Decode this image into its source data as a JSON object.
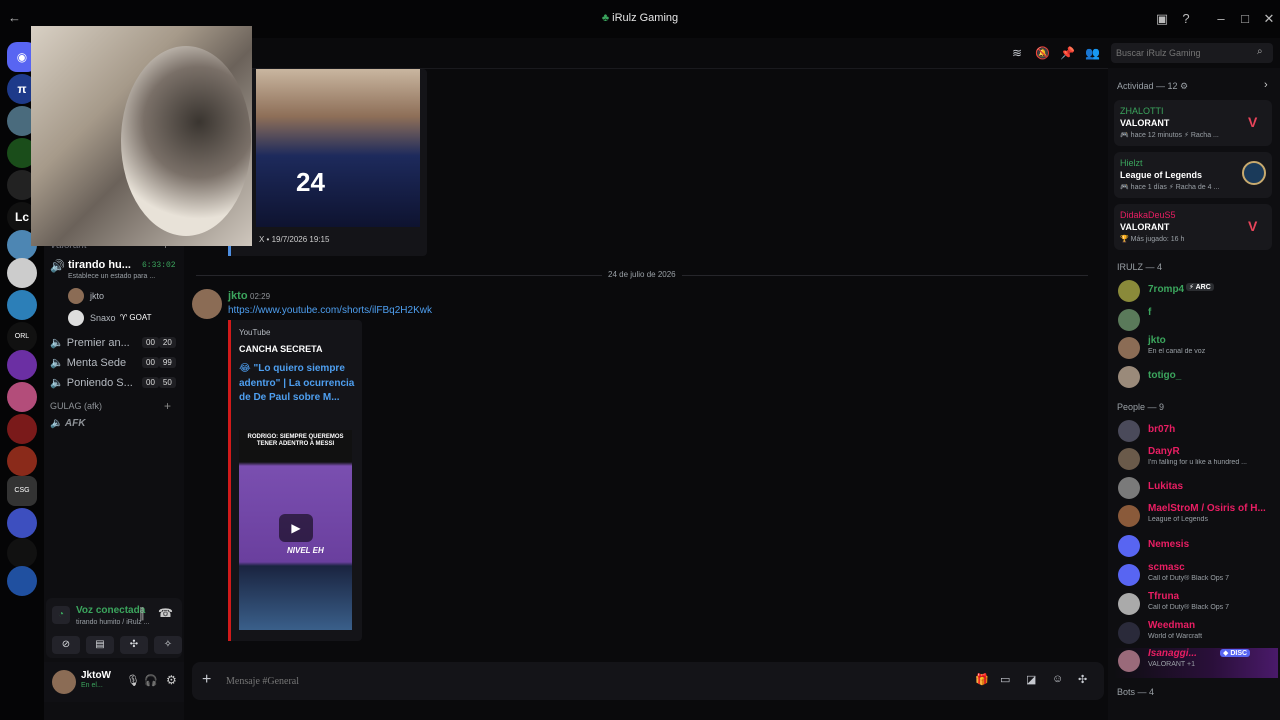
{
  "window": {
    "title": "iRulz Gaming"
  },
  "search": {
    "placeholder": "Buscar iRulz Gaming"
  },
  "channels": {
    "category_valorant": "Valorant",
    "active_channel": "tirando hu...",
    "active_timer": "6:33:02",
    "status_hint": "Establece un estado para ...",
    "users": [
      {
        "name": "jkto"
      },
      {
        "name": "Snaxo",
        "badge": "GOAT"
      }
    ],
    "voice": [
      {
        "name": "Premier an...",
        "a": "00",
        "b": "20"
      },
      {
        "name": "Menta Sede",
        "a": "00",
        "b": "99"
      },
      {
        "name": "Poniendo S...",
        "a": "00",
        "b": "50"
      }
    ],
    "category_gulag": "GULAG (afk)",
    "afk": "AFK"
  },
  "voice_panel": {
    "status": "Voz conectada",
    "channel": "tirando humito / iRulz ..."
  },
  "user_panel": {
    "name": "JktoW",
    "status": "En el..."
  },
  "messages": {
    "prev_embed_footer": "X • 19/7/2026 19:15",
    "date_divider": "24 de julio de 2026",
    "author": "jkto",
    "time": "02:29",
    "link": "https://www.youtube.com/shorts/ilFBq2H2Kwk",
    "embed": {
      "provider": "YouTube",
      "author": "CANCHA SECRETA",
      "title": "😂 \"Lo quiero siempre adentro\" | La ocurrencia de De Paul sobre M...",
      "thumb_caption": "RODRIGO: SIEMPRE QUEREMOS TENER ADENTRO A MESSI",
      "thumb_tag": "NIVEL EH"
    }
  },
  "composer": {
    "placeholder": "Mensaje #General"
  },
  "members": {
    "activity_header": "Actividad — 12",
    "activities": [
      {
        "user": "ZHALOTTI",
        "game": "VALORANT",
        "meta": "hace 12 minutos",
        "extra": "Racha ...",
        "color": "#3ba55d"
      },
      {
        "user": "Hielzt",
        "game": "League of Legends",
        "meta": "hace 1 días",
        "extra": "Racha de 4 ...",
        "color": "#3ba55d"
      },
      {
        "user": "DidakaDeuS5",
        "game": "VALORANT",
        "meta": "Más jugado: 16 h",
        "extra": "",
        "color": "#e91e63"
      }
    ],
    "group1_header": "IRULZ — 4",
    "group1": [
      {
        "name": "7romp4",
        "sub": "",
        "tag": "ARC",
        "color": "#3ba55d"
      },
      {
        "name": "f",
        "sub": "",
        "tag": "",
        "color": "#3ba55d"
      },
      {
        "name": "jkto",
        "sub": "En el canal de voz",
        "tag": "",
        "color": "#3ba55d"
      },
      {
        "name": "totigo_",
        "sub": "",
        "tag": "",
        "color": "#3ba55d"
      }
    ],
    "group2_header": "People — 9",
    "group2": [
      {
        "name": "br07h",
        "sub": "",
        "color": "#e91e63"
      },
      {
        "name": "DanyR",
        "sub": "I'm falling for u like a hundred ...",
        "color": "#e91e63"
      },
      {
        "name": "Lukitas",
        "sub": "",
        "color": "#e91e63"
      },
      {
        "name": "MaelStroM / Osiris of H...",
        "sub": "League of Legends",
        "color": "#e91e63"
      },
      {
        "name": "Nemesis",
        "sub": "",
        "color": "#e91e63"
      },
      {
        "name": "scmasc",
        "sub": "Call of Duty® Black Ops 7",
        "color": "#e91e63"
      },
      {
        "name": "Tfruna",
        "sub": "Call of Duty® Black Ops 7",
        "color": "#e91e63"
      },
      {
        "name": "Weedman",
        "sub": "World of Warcraft",
        "color": "#e91e63"
      },
      {
        "name": "Isanaggi...",
        "sub": "VALORANT +1",
        "tag": "DISC",
        "color": "#e91e63"
      }
    ],
    "group3_header": "Bots — 4"
  }
}
